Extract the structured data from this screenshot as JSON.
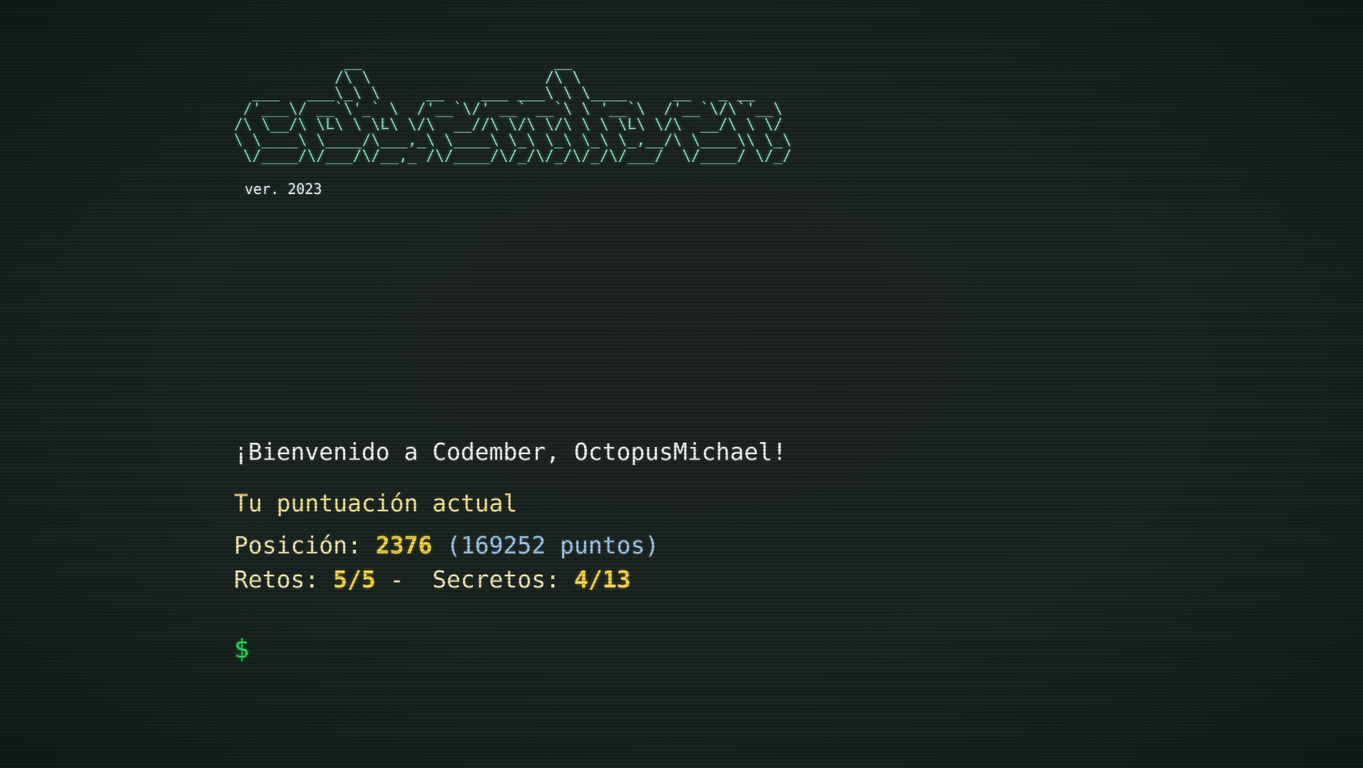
{
  "header": {
    "logo_ascii": "            __                     __\n           /\\ \\                   /\\ \\\n  ___   ___\\_\\ \\     __    ___ ___\\ \\ \\____     __   _ __\n /'___\\/ __`\\'_` \\  /'__`\\/' __` __`\\ \\ '__`\\  /'__`\\/\\`'__\\\n/\\ \\__/\\ \\L\\ \\ \\L\\ \\/\\  __//\\ \\/\\ \\/\\ \\ \\ \\L\\ \\/\\  __/\\ \\ \\/\n\\ \\____\\ \\____/\\___,_\\ \\____\\ \\_\\ \\_\\ \\_\\ \\_,__/\\ \\____\\\\ \\_\\\n \\/____/\\/___/\\/__,_ /\\/____/\\/_/\\/_/\\/_/\\/___/  \\/____/ \\/_/",
    "version": "ver. 2023"
  },
  "terminal": {
    "welcome": "¡Bienvenido a Codember, OctopusMichael!",
    "score_title": "Tu puntuación actual",
    "position_label": "Posición: ",
    "position_value": "2376",
    "points_text": "(169252 puntos)",
    "challenges_label": "Retos: ",
    "challenges_value": "5/5",
    "separator": " - ",
    "secrets_label": "Secretos: ",
    "secrets_value": "4/13",
    "prompt_symbol": "$",
    "input_value": ""
  },
  "colors": {
    "background": "#1b2521",
    "prompt": "#2fe55f",
    "highlight": "#f5d34a",
    "points": "#9fc6e8",
    "title": "#f1e08a"
  }
}
